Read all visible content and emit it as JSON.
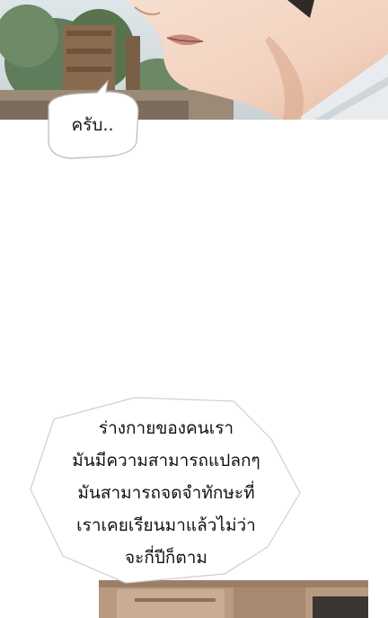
{
  "panels": [
    {
      "scene": "close-up of smiling face, trees and wooden structure in background"
    },
    {
      "scene": "wooden furniture interior"
    }
  ],
  "bubbles": {
    "reply": {
      "text": "ครับ.."
    },
    "narration": {
      "lines": [
        "ร่างกายของคนเรา",
        "มันมีความสามารถแปลกๆ",
        "มันสามารถจดจำทักษะที่",
        "เราเคยเรียนมาแล้วไม่ว่า",
        "จะกี่ปีก็ตาม"
      ]
    }
  }
}
